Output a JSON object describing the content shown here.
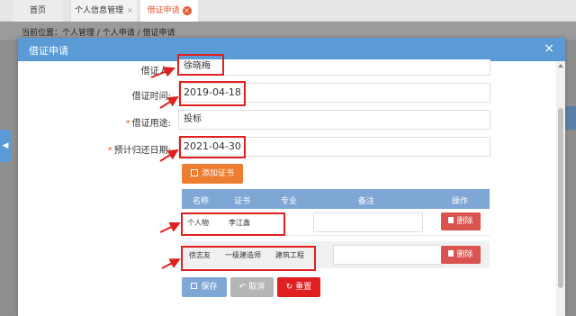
{
  "tabs": {
    "home": "首页",
    "personal_info": "个人信息管理",
    "personal_info_close": "×",
    "active": "借证申请",
    "active_close": "×"
  },
  "breadcrumb": "当前位置：个人管理 / 个人申请 / 借证申请",
  "side_toggle": "◀",
  "modal": {
    "title": "借证申请",
    "close": "×"
  },
  "form": {
    "borrower_label": "借证人:",
    "borrower_value": "徐晓梅",
    "borrow_date_label": "借证时间:",
    "borrow_date_value": "2019-04-18",
    "purpose_required": "*",
    "purpose_label": "借证用途:",
    "purpose_value": "投标",
    "return_date_required": "*",
    "return_date_label": "预计归还日期:",
    "return_date_value": "2021-04-30"
  },
  "add_cert_button": {
    "icon": "add-doc-icon",
    "label": "添加证书"
  },
  "table": {
    "headers": [
      "名称",
      "证书",
      "专业",
      "备注",
      "操作"
    ],
    "rows": [
      {
        "name": "个人物",
        "cert": "李江鑫",
        "major": "",
        "note": "",
        "action": "删除"
      },
      {
        "name": "徐志友",
        "cert": "一级建造师",
        "major": "建筑工程",
        "note": "",
        "action": "删除"
      }
    ]
  },
  "footer": {
    "save": "保存",
    "cancel": "取消",
    "reset": "重置"
  },
  "colors": {
    "header_blue": "#5b9bd5",
    "accent_orange": "#ed7d31",
    "delete_red": "#d9534f",
    "annotation_red": "#e02020"
  }
}
